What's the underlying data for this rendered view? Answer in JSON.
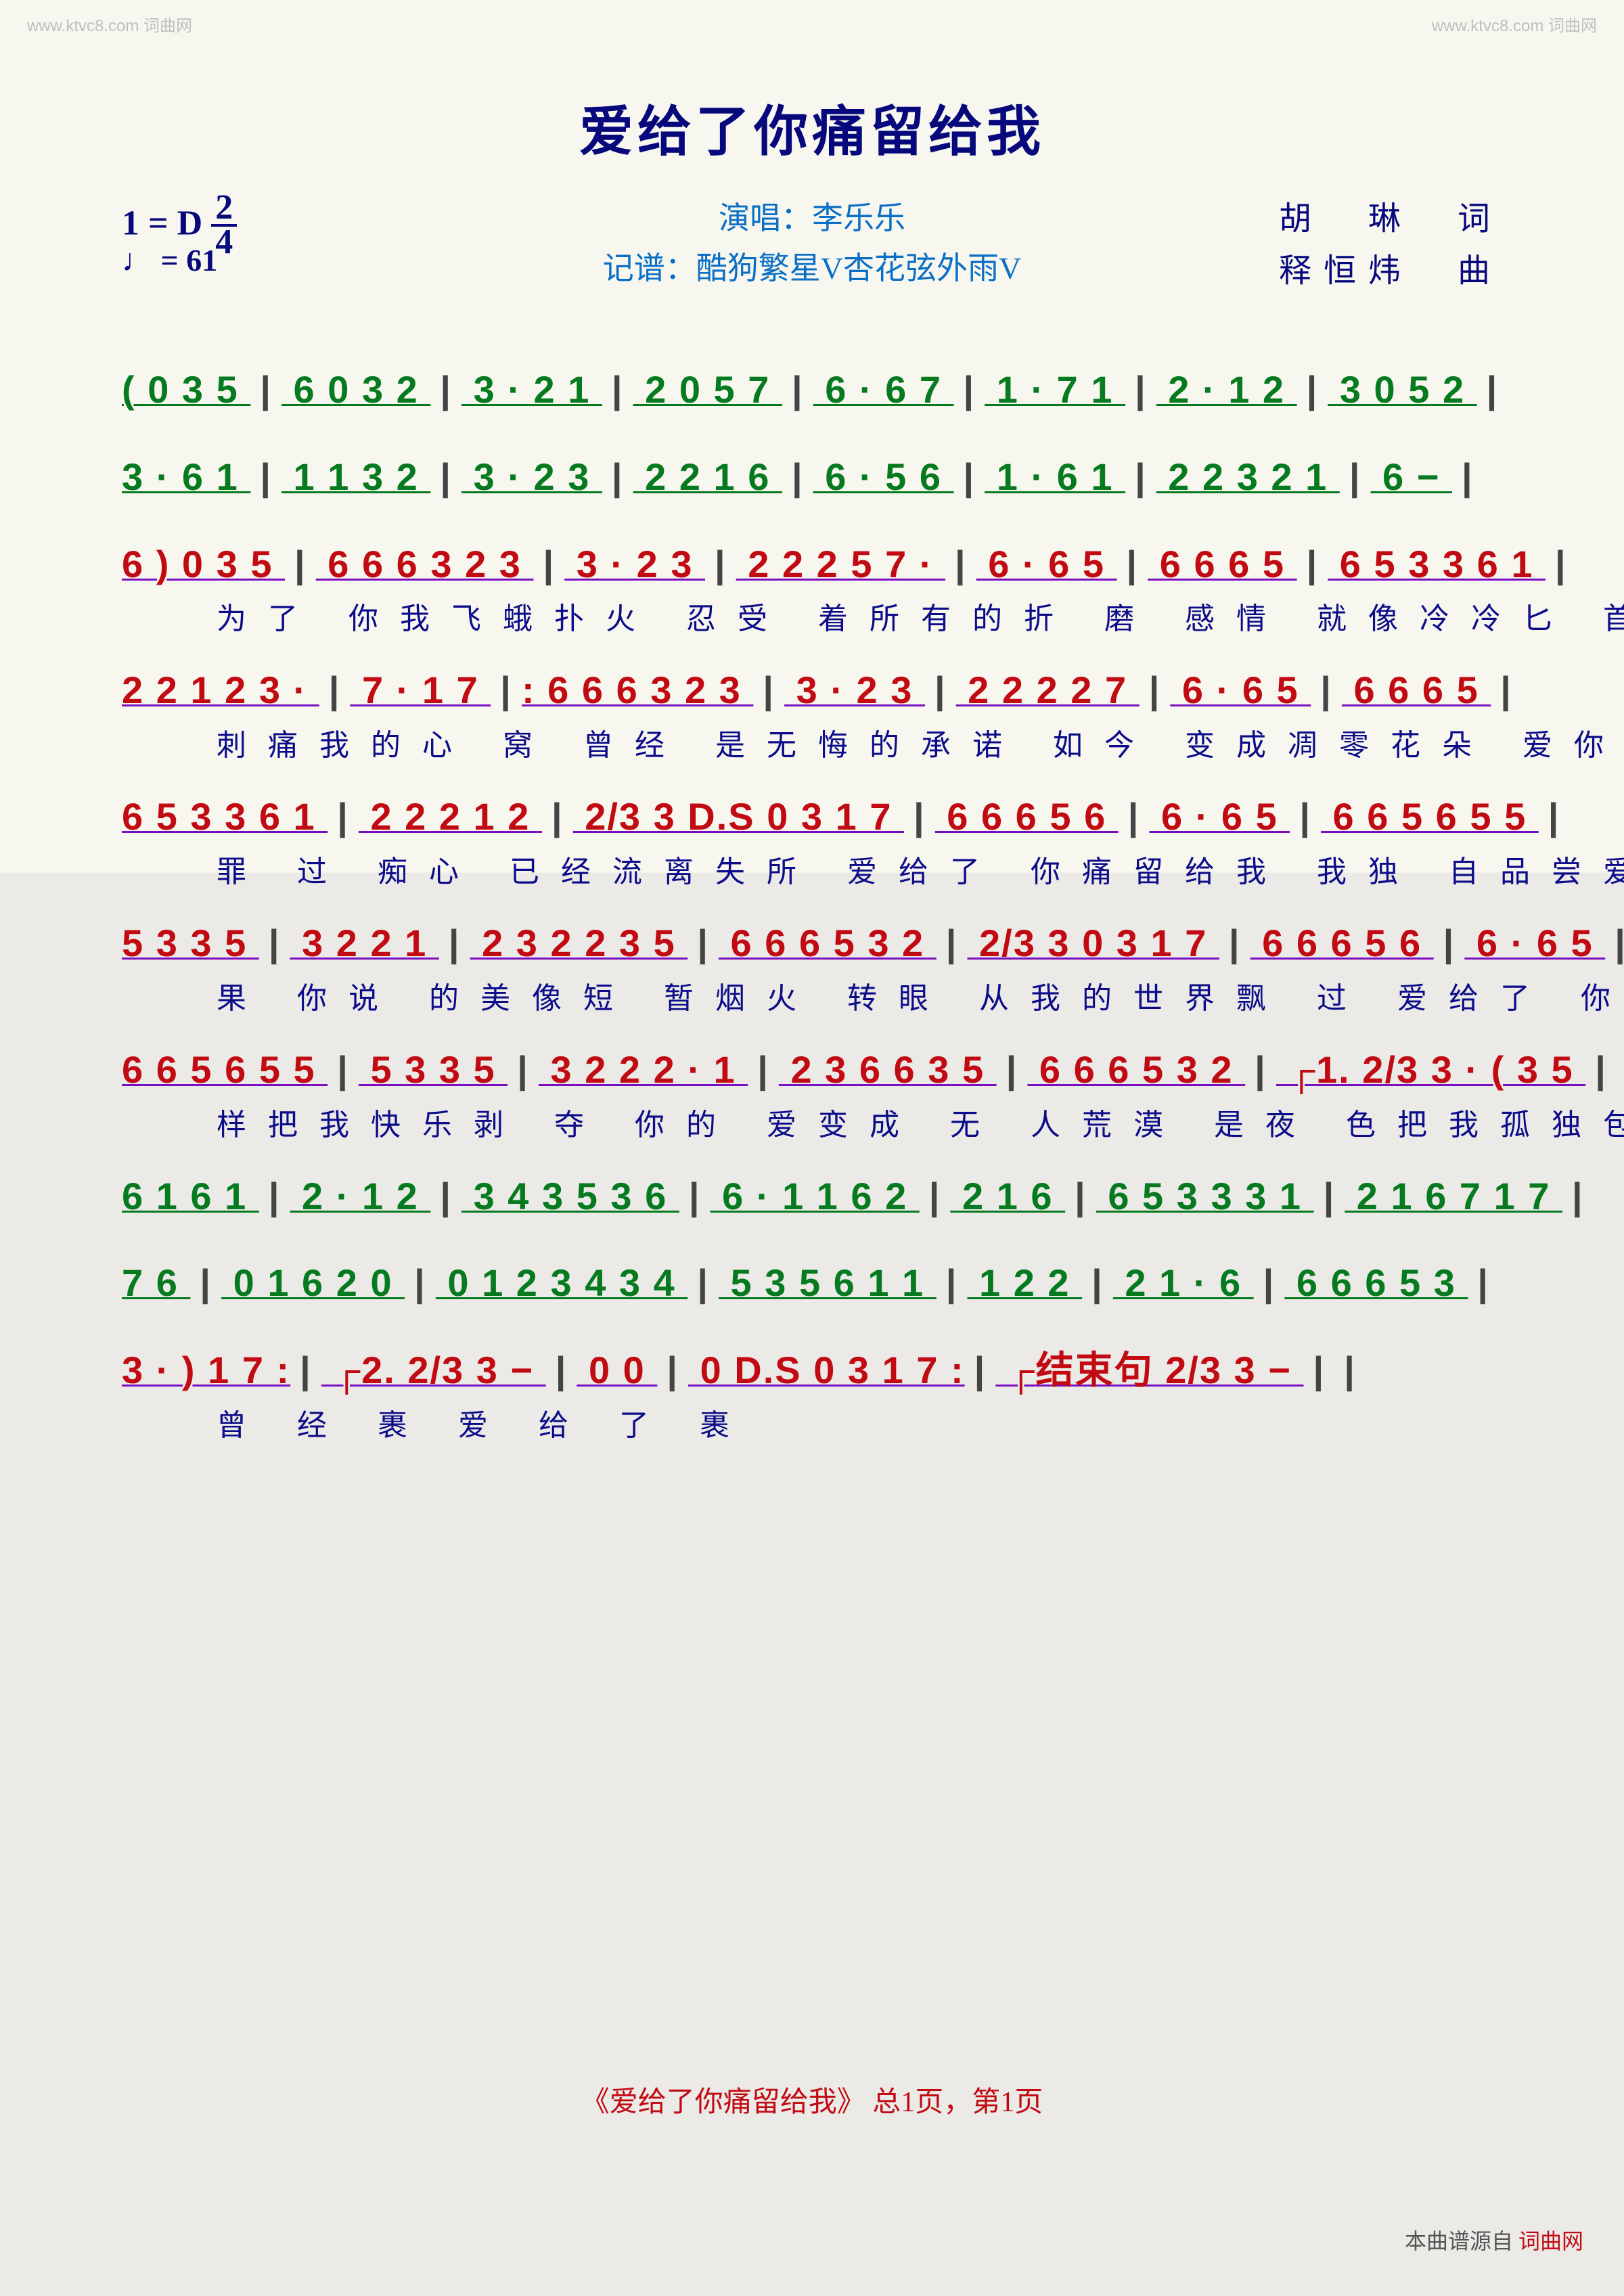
{
  "watermark": "www.ktvc8.com 词曲网",
  "title": "爱给了你痛留给我",
  "key_text": "1 = D",
  "time_num": "2",
  "time_den": "4",
  "tempo": "♩ = 61",
  "singer_label": "演唱：李乐乐",
  "transcriber_label": "记谱：酷狗繁星V杏花弦外雨V",
  "lyricist": "胡　琳　词",
  "composer": "释恒炜　曲",
  "lines": [
    {
      "notes": "( 0 3 5 | 6  0 3 2 | 3 ·  2 1 | 2  0 5 7 | 6 ·  6 7 | 1 ·  7 1 | 2 ·  1 2 | 3  0 5 2 |",
      "color": "green",
      "lyrics": ""
    },
    {
      "notes": "3 ·  6 1 | 1  1 3 2 | 3 ·  2 3 | 2  2 1 6 | 6 ·  5 6 | 1 ·  6 1 | 2  2 3 2 1 | 6  − |",
      "color": "green",
      "lyrics": ""
    },
    {
      "notes": "6 )  0 3 5 | 6 6 6  3 2 3 | 3 ·  2 3 | 2 2 2  5 7 · | 6 ·  6 5 | 6 6  6 5 | 6 5 3  3 6 1 |",
      "color": "red",
      "lyrics": "为了 你我飞蛾扑火  忍受 着所有的折  磨 感情 就像冷冷匕 首  狠狠"
    },
    {
      "notes": "2 2 1  2 3 · | 7 ·  1 7 |: 6 6 6  3 2 3 | 3 ·  2 3 | 2 2 2  2 7 | 6 ·  6 5 | 6 6  6 5 |",
      "color": "red",
      "lyrics": "刺痛我的心  窝  曾经 是无悔的承诺  如今 变成凋零花朵 爱你 就是无情"
    },
    {
      "notes": "6 5 3  3 6 1 | 2 2  2 1 2 | 2/3 3  D.S 0 3 1 7 | 6 6  6 5 6 | 6 ·  6 5 | 6 6 5  6 5 5 |",
      "color": "red",
      "lyrics": "罪  过  痴心 已经流离失所  爱给了 你痛留给我  我独 自品尝爱的苦"
    },
    {
      "notes": "5 3  3 5 | 3 2  2 1 | 2 3 2  2 3 5 | 6 6 6  5 3 2 | 2/3 3  0 3 1 7 | 6 6  6 5 6 | 6 ·  6 5 |",
      "color": "red",
      "lyrics": "果 你说 的美像短 暂烟火 转眼 从我的世界飘 过 爱给了 你痛留给我  就这"
    },
    {
      "notes": "6 6 5  6 5 5 | 5 3  3 5 | 3 2 2  2 · 1 | 2 3 6  6 3 5 | 6 6 6  5 3 2 | ┌1. 2/3 3 ·  ( 3 5 |",
      "color": "red",
      "lyrics": "样把我快乐剥  夺 你的 爱变成  无 人荒漠 是夜 色把我孤独包  裹"
    },
    {
      "notes": "6  1 6 1 | 2 ·  1 2 | 3 4 3  5 3 6 | 6 · 1  1 6 2 | 2 1 6 | 6 5 3  3 3 1 | 2 1 6  7 1 7 |",
      "color": "green",
      "lyrics": ""
    },
    {
      "notes": "7  6 | 0 1 6  2  0 | 0 1 2  3 4 3 4 | 5 3 5  6 1 1 | 1 2  2 | 2  1 · 6 | 6 6 6  5 3 |",
      "color": "green",
      "lyrics": ""
    },
    {
      "notes": "3 · )  1 7 :| ┌2. 2/3 3  − | 0  0 | 0  D.S  0 3 1 7 :| ┌结束句 2/3 3  − ||",
      "color": "red",
      "lyrics": "曾 经  裹                           爱 给 了   裹"
    }
  ],
  "footer": "《爱给了你痛留给我》 总1页，第1页",
  "source_prefix": "本曲谱源自",
  "source_link": "词曲网"
}
